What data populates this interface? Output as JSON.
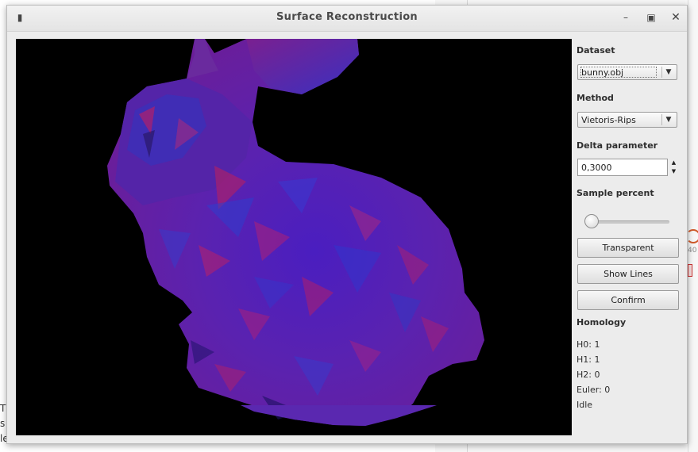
{
  "window": {
    "title": "Surface Reconstruction"
  },
  "panel": {
    "dataset_label": "Dataset",
    "dataset_value": "bunny.obj",
    "method_label": "Method",
    "method_value": "Vietoris-Rips",
    "delta_label": "Delta parameter",
    "delta_value": "0,3000",
    "sample_label": "Sample percent",
    "sample_percent_level": 0.0,
    "transparent_label": "Transparent",
    "show_lines_label": "Show Lines",
    "confirm_label": "Confirm",
    "homology_label": "Homology",
    "h0": "H0: 1",
    "h1": "H1: 1",
    "h2": "H2: 0",
    "euler": "Euler: 0",
    "status": "Idle"
  },
  "background": {
    "fragment_left": [
      "T",
      "s",
      "le"
    ],
    "fragment_right": [
      "40"
    ]
  },
  "colors": {
    "viewport_bg": "#000000",
    "mesh_primary": "#5a1fb0",
    "mesh_secondary": "#2a3fd0",
    "mesh_accent": "#b0206a"
  },
  "icons": {
    "menu": "window-menu-icon",
    "minimize": "minimize-icon",
    "maximize": "maximize-icon",
    "close": "close-icon",
    "dropdown": "chevron-down-icon"
  }
}
